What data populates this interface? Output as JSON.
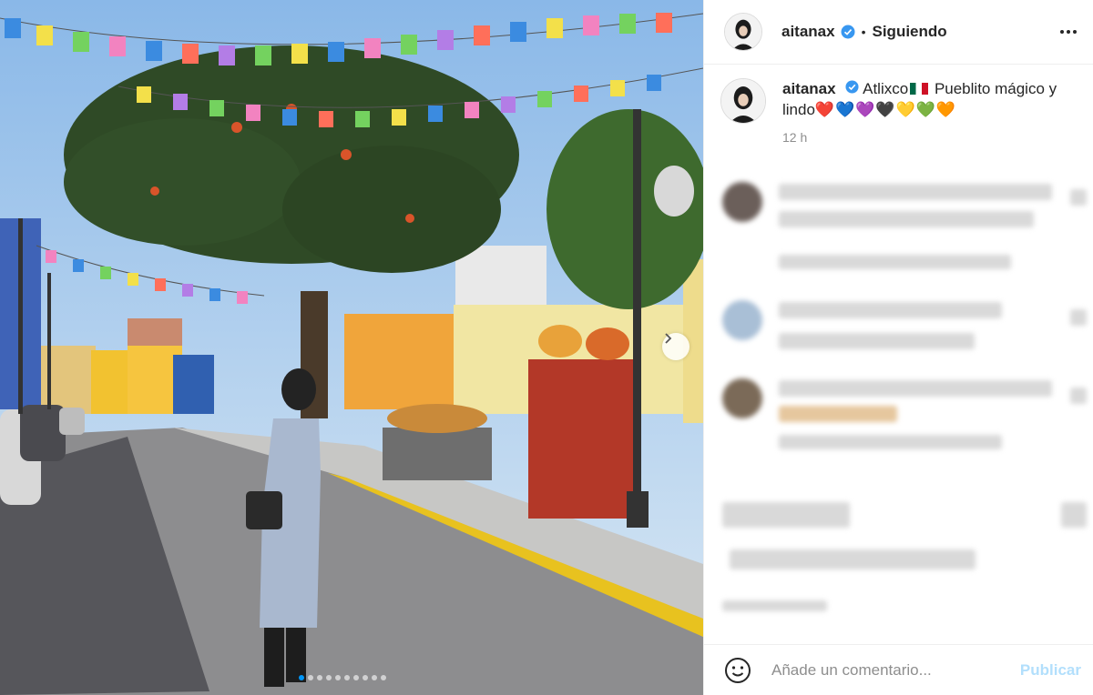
{
  "post": {
    "author": "aitanax",
    "follow_status": "Siguiendo",
    "separator": "•",
    "caption_place": "Atlixco",
    "caption_text": "Pueblito mágico y lindo",
    "caption_hearts": "❤️💙💜🖤💛💚🧡",
    "time": "12 h",
    "carousel_total": 10,
    "carousel_active": 0
  },
  "comment_box": {
    "placeholder": "Añade un comentario...",
    "publish_label": "Publicar"
  },
  "colors": {
    "verified": "#3897f0",
    "publish_disabled": "#b2dffc",
    "carousel_active_dot": "#0095f6"
  },
  "icons": {
    "verified": "verified-badge-icon",
    "more": "more-options-icon",
    "next": "chevron-right-icon",
    "emoji": "smiley-emoji-icon"
  }
}
